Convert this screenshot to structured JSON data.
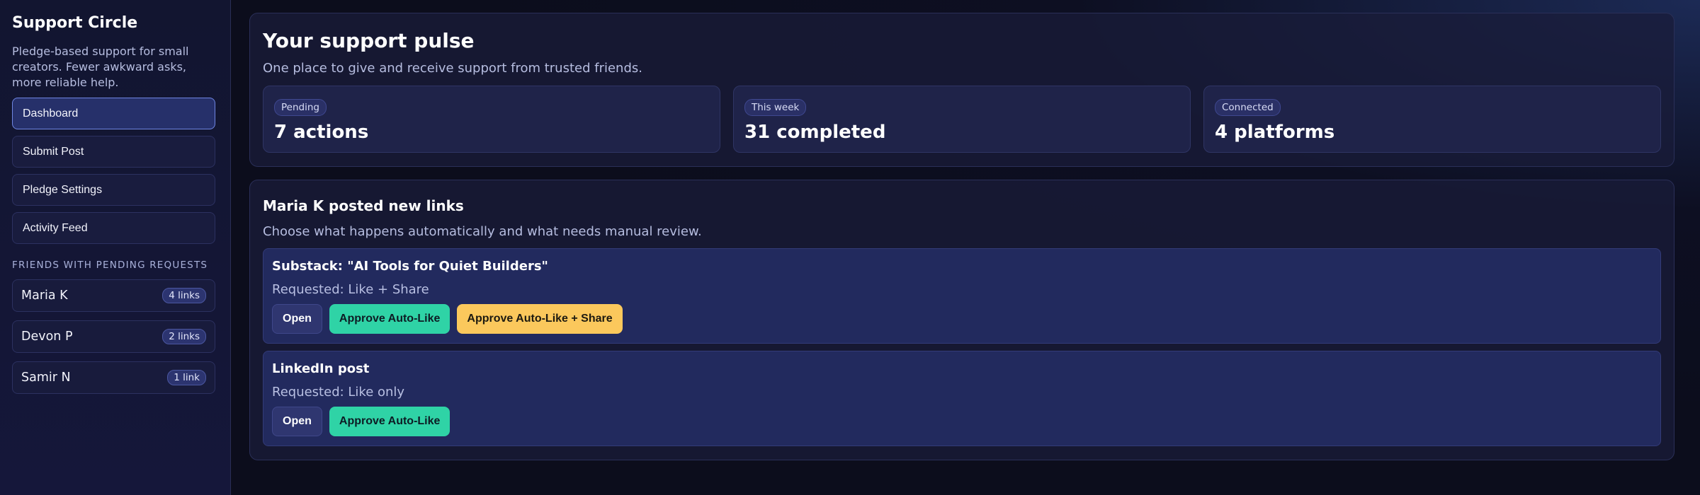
{
  "sidebar": {
    "title": "Support Circle",
    "description": "Pledge-based support for small creators. Fewer awkward asks, more reliable help.",
    "nav": [
      {
        "label": "Dashboard",
        "active": true
      },
      {
        "label": "Submit Post",
        "active": false
      },
      {
        "label": "Pledge Settings",
        "active": false
      },
      {
        "label": "Activity Feed",
        "active": false
      }
    ],
    "section_label": "Friends with pending requests",
    "friends": [
      {
        "name": "Maria K",
        "badge": "4 links"
      },
      {
        "name": "Devon P",
        "badge": "2 links"
      },
      {
        "name": "Samir N",
        "badge": "1 link"
      }
    ]
  },
  "pulse": {
    "title": "Your support pulse",
    "subtitle": "One place to give and receive support from trusted friends.",
    "stats": [
      {
        "pill": "Pending",
        "value": "7 actions"
      },
      {
        "pill": "This week",
        "value": "31 completed"
      },
      {
        "pill": "Connected",
        "value": "4 platforms"
      }
    ]
  },
  "links": {
    "title": "Maria K posted new links",
    "subtitle": "Choose what happens automatically and what needs manual review.",
    "cards": [
      {
        "title": "Substack: \"AI Tools for Quiet Builders\"",
        "requested": "Requested: Like + Share",
        "open_label": "Open",
        "approve_like_label": "Approve Auto-Like",
        "approve_share_label": "Approve Auto-Like + Share"
      },
      {
        "title": "LinkedIn post",
        "requested": "Requested: Like only",
        "open_label": "Open",
        "approve_like_label": "Approve Auto-Like"
      }
    ]
  },
  "colors": {
    "accent_green": "#2fd3a6",
    "accent_yellow": "#fbc85c",
    "active_nav_border": "#6f86e2"
  }
}
